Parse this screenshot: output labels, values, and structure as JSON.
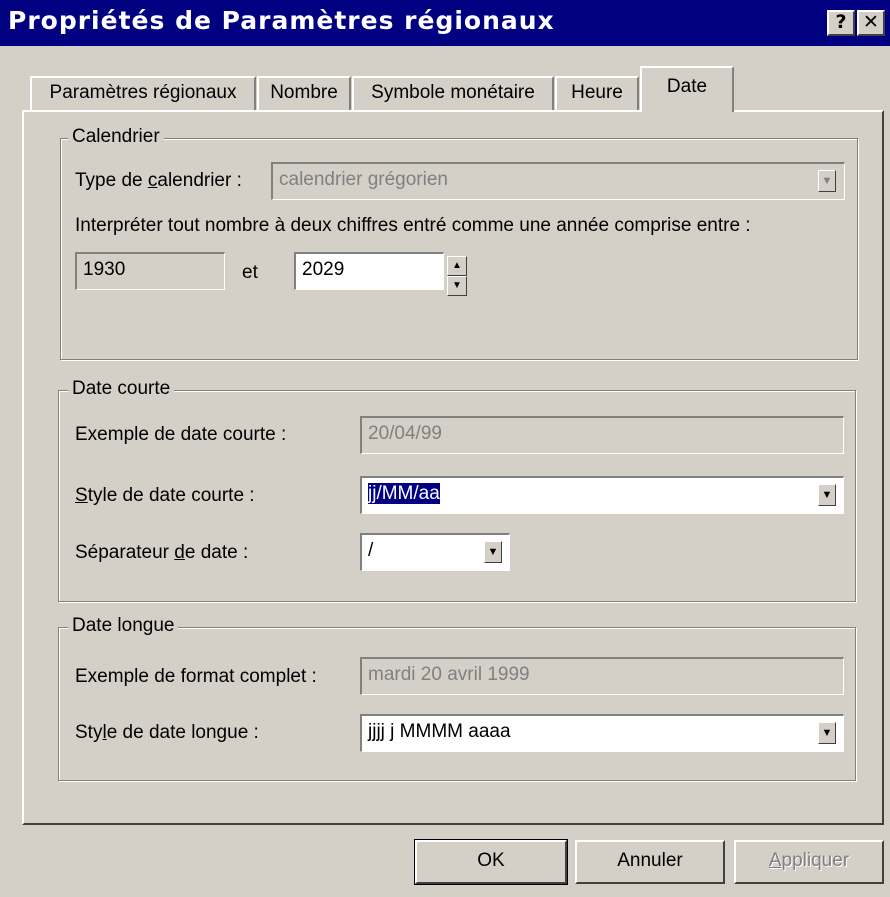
{
  "window": {
    "title": "Propriétés de Paramètres régionaux",
    "help_glyph": "?",
    "close_glyph": "✕"
  },
  "tabs": [
    {
      "label": "Paramètres régionaux"
    },
    {
      "label": "Nombre"
    },
    {
      "label": "Symbole monétaire"
    },
    {
      "label": "Heure"
    },
    {
      "label": "Date",
      "active": true
    }
  ],
  "calendar": {
    "group_title": "Calendrier",
    "type_label_pre": "Type de ",
    "type_label_accel": "c",
    "type_label_post": "alendrier :",
    "type_value": "calendrier grégorien",
    "interpret_label": "Interpréter tout nombre à deux chiffres entré comme une année comprise entre :",
    "year_start": "1930",
    "and_label": "et",
    "year_end": "2029"
  },
  "short_date": {
    "group_title": "Date courte",
    "example_label": "Exemple de date courte :",
    "example_value": "20/04/99",
    "style_label_accel": "S",
    "style_label_rest": "tyle de date courte :",
    "style_value": "jj/MM/aa",
    "separator_label_pre": "Séparateur ",
    "separator_label_accel": "d",
    "separator_label_post": "e date :",
    "separator_value": "/"
  },
  "long_date": {
    "group_title": "Date longue",
    "example_label": "Exemple de format complet :",
    "example_value": "mardi 20 avril 1999",
    "style_label_pre": "Sty",
    "style_label_accel": "l",
    "style_label_post": "e de date longue :",
    "style_value": "jjjj j MMMM aaaa"
  },
  "buttons": {
    "ok": "OK",
    "cancel": "Annuler",
    "apply_accel": "A",
    "apply_rest": "ppliquer"
  }
}
